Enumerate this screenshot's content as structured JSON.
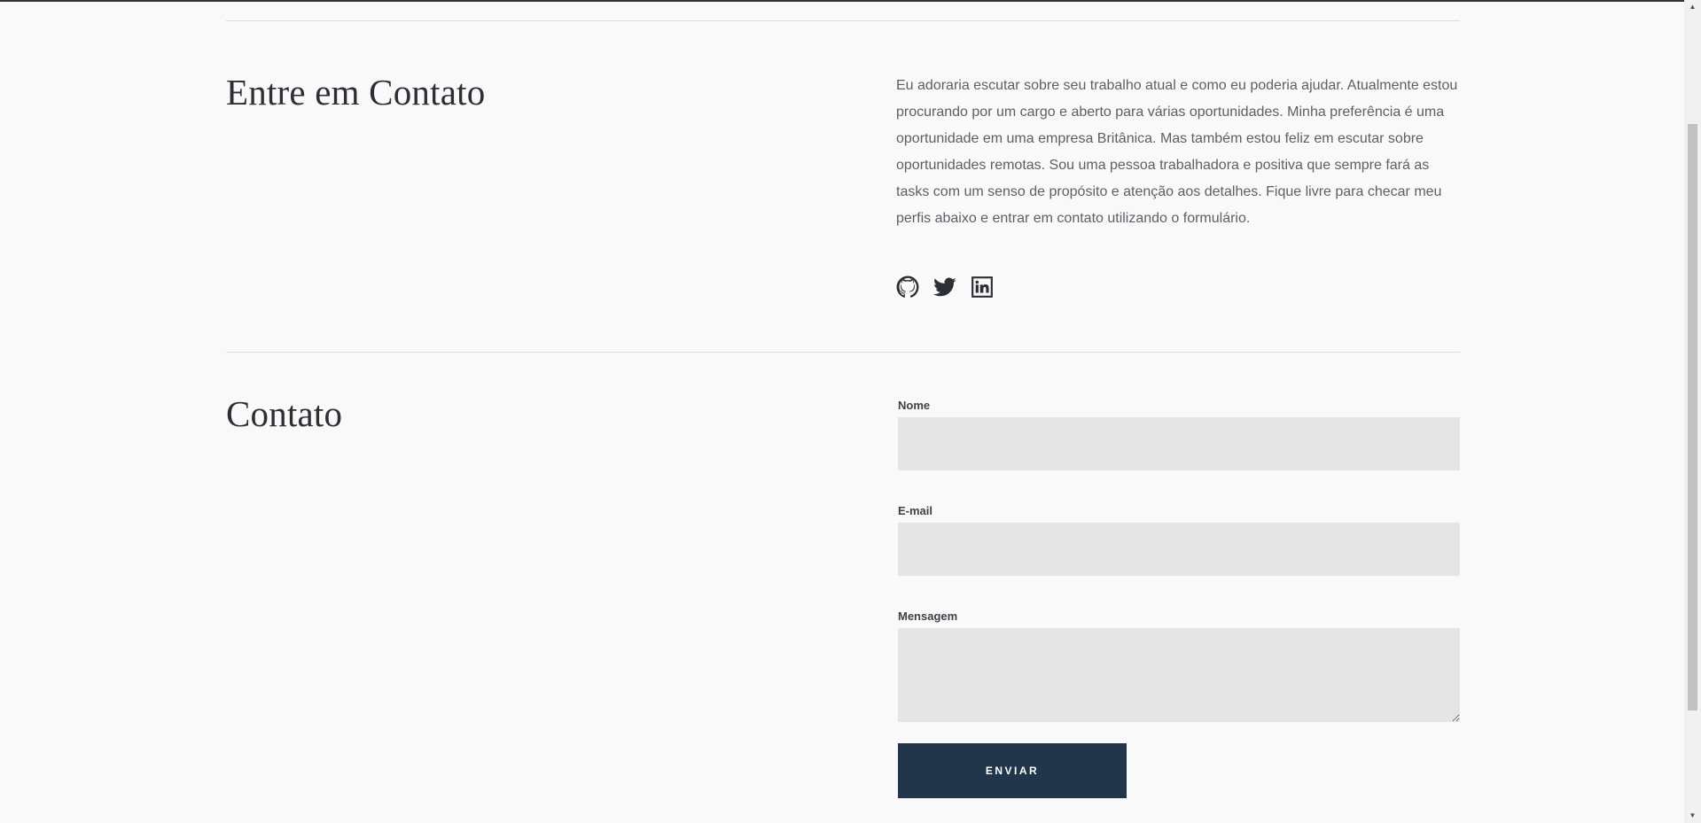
{
  "get_in_touch": {
    "heading": "Entre em Contato",
    "description": "Eu adoraria escutar sobre seu trabalho atual e como eu poderia ajudar. Atualmente estou procurando por um cargo e aberto para várias oportunidades. Minha preferência é uma oportunidade em uma empresa Britânica. Mas também estou feliz em escutar sobre oportunidades remotas. Sou uma pessoa trabalhadora e positiva que sempre fará as tasks com um senso de propósito e atenção aos detalhes. Fique livre para checar meu perfis abaixo e entrar em contato utilizando o formulário.",
    "social_icons": [
      "github-icon",
      "twitter-icon",
      "linkedin-icon"
    ]
  },
  "contact": {
    "heading": "Contato",
    "form": {
      "name_label": "Nome",
      "name_value": "",
      "email_label": "E-mail",
      "email_value": "",
      "message_label": "Mensagem",
      "message_value": "",
      "submit_label": "ENVIAR"
    }
  },
  "colors": {
    "background": "#f9f9f9",
    "heading_text": "#2d2f36",
    "body_text": "#5c5f66",
    "input_background": "#e5e5e5",
    "button_background": "#21364a",
    "button_text": "#ffffff"
  },
  "scrollbar": {
    "up_icon": "scroll-up-arrow-icon",
    "down_icon": "scroll-down-arrow-icon"
  }
}
